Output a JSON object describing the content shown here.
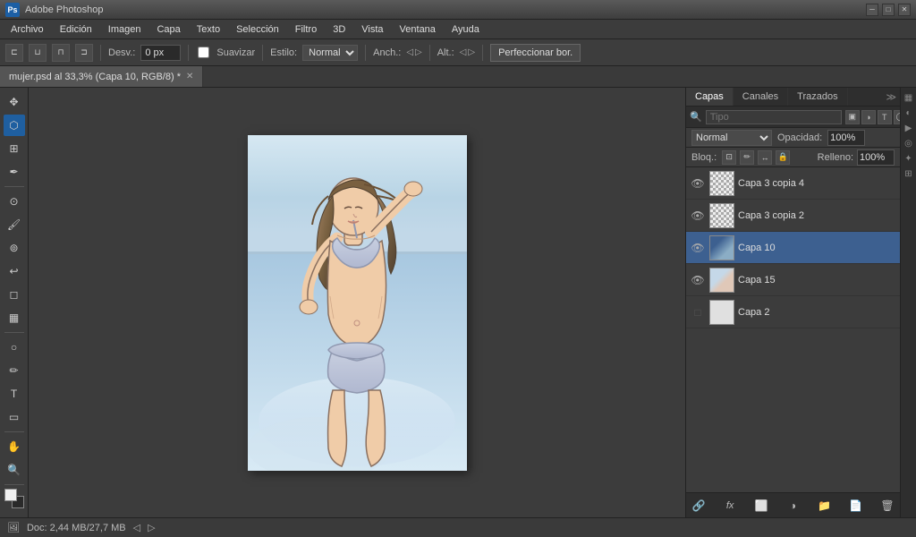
{
  "titlebar": {
    "app_name": "Adobe Photoshop",
    "app_icon": "Ps"
  },
  "menu": {
    "items": [
      "Archivo",
      "Edición",
      "Imagen",
      "Capa",
      "Texto",
      "Selección",
      "Filtro",
      "3D",
      "Vista",
      "Ventana",
      "Ayuda"
    ]
  },
  "toolbar": {
    "desvlabel": "Desv.:",
    "desv_value": "0 px",
    "suavizar_label": "Suavizar",
    "estilo_label": "Estilo:",
    "estilo_value": "Normal",
    "anch_label": "Anch.:",
    "alt_label": "Alt.:",
    "perfeccionar_btn": "Perfeccionar bor."
  },
  "document": {
    "tab_label": "mujer.psd al 33,3% (Capa 10, RGB/8) *"
  },
  "layers_panel": {
    "tabs": [
      "Capas",
      "Canales",
      "Trazados"
    ],
    "active_tab": "Capas",
    "search_placeholder": "Tipo",
    "blend_mode": "Normal",
    "opacity_label": "Opacidad:",
    "opacity_value": "100%",
    "lock_label": "Bloq.:",
    "fill_label": "Relleno:",
    "fill_value": "100%",
    "layers": [
      {
        "name": "Capa 3 copia 4",
        "visible": true,
        "active": false,
        "thumb": "checker"
      },
      {
        "name": "Capa 3 copia 2",
        "visible": true,
        "active": false,
        "thumb": "blue-pink"
      },
      {
        "name": "Capa 10",
        "visible": true,
        "active": true,
        "thumb": "highlight"
      },
      {
        "name": "Capa 15",
        "visible": true,
        "active": false,
        "thumb": "light-blue"
      },
      {
        "name": "Capa 2",
        "visible": false,
        "active": false,
        "thumb": "white"
      }
    ],
    "bottom_icons": [
      "link-icon",
      "fx-icon",
      "mask-icon",
      "adjustment-icon",
      "folder-icon",
      "new-layer-icon",
      "delete-icon"
    ]
  },
  "status_bar": {
    "doc_info": "Doc: 2,44 MB/27,7 MB"
  }
}
